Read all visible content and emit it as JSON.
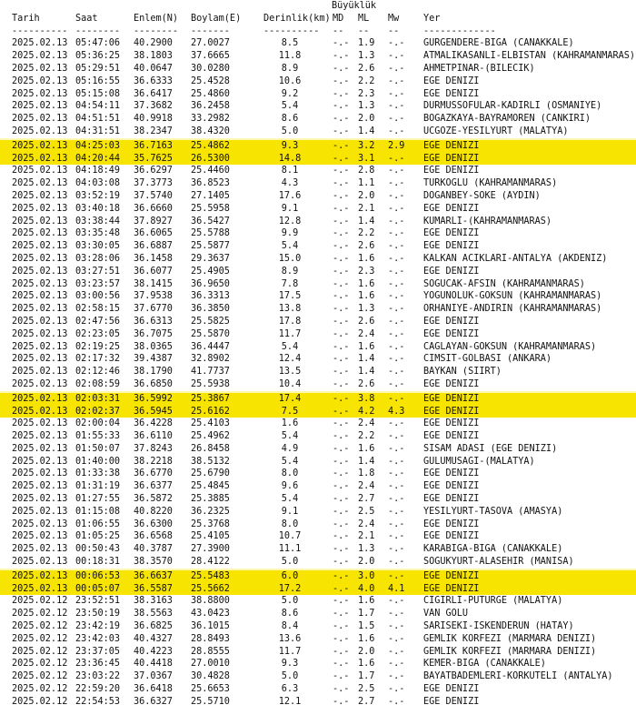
{
  "title_line": "Büyüklük",
  "headers": {
    "date": "Tarih",
    "time": "Saat",
    "lat": "Enlem(N)",
    "lon": "Boylam(E)",
    "depth": "Derinlik(km)",
    "md": "MD",
    "ml": "ML",
    "mw": "Mw",
    "loc": "Yer"
  },
  "dashes": {
    "date": "----------",
    "time": "--------",
    "lat": "--------",
    "lon": "-------",
    "depth": "----------",
    "md": "--",
    "ml": "--",
    "mw": "--",
    "loc": "-------------"
  },
  "rows": [
    {
      "date": "2025.02.13",
      "time": "05:47:06",
      "lat": "40.2900",
      "lon": "27.0027",
      "depth": "8.5",
      "md": "-.-",
      "ml": "1.9",
      "mw": "-.-",
      "loc": "GURGENDERE-BIGA (CANAKKALE)"
    },
    {
      "date": "2025.02.13",
      "time": "05:36:25",
      "lat": "38.1803",
      "lon": "37.6665",
      "depth": "11.8",
      "md": "-.-",
      "ml": "1.3",
      "mw": "-.-",
      "loc": "ATMALIKASANLI-ELBISTAN (KAHRAMANMARAS)"
    },
    {
      "date": "2025.02.13",
      "time": "05:29:51",
      "lat": "40.0647",
      "lon": "30.0280",
      "depth": "8.9",
      "md": "-.-",
      "ml": "2.6",
      "mw": "-.-",
      "loc": "AHMETPINAR-(BILECIK)"
    },
    {
      "date": "2025.02.13",
      "time": "05:16:55",
      "lat": "36.6333",
      "lon": "25.4528",
      "depth": "10.6",
      "md": "-.-",
      "ml": "2.2",
      "mw": "-.-",
      "loc": "EGE DENIZI"
    },
    {
      "date": "2025.02.13",
      "time": "05:15:08",
      "lat": "36.6417",
      "lon": "25.4860",
      "depth": "9.2",
      "md": "-.-",
      "ml": "2.3",
      "mw": "-.-",
      "loc": "EGE DENIZI"
    },
    {
      "date": "2025.02.13",
      "time": "04:54:11",
      "lat": "37.3682",
      "lon": "36.2458",
      "depth": "5.4",
      "md": "-.-",
      "ml": "1.3",
      "mw": "-.-",
      "loc": "DURMUSSOFULAR-KADIRLI (OSMANIYE)"
    },
    {
      "date": "2025.02.13",
      "time": "04:51:51",
      "lat": "40.9918",
      "lon": "33.2982",
      "depth": "8.6",
      "md": "-.-",
      "ml": "2.0",
      "mw": "-.-",
      "loc": "BOGAZKAYA-BAYRAMOREN (CANKIRI)"
    },
    {
      "date": "2025.02.13",
      "time": "04:31:51",
      "lat": "38.2347",
      "lon": "38.4320",
      "depth": "5.0",
      "md": "-.-",
      "ml": "1.4",
      "mw": "-.-",
      "loc": "UCGOZE-YESILYURT (MALATYA)"
    },
    {
      "date": "2025.02.13",
      "time": "04:25:03",
      "lat": "36.7163",
      "lon": "25.4862",
      "depth": "9.3",
      "md": "-.-",
      "ml": "3.2",
      "mw": "2.9",
      "loc": "EGE DENIZI",
      "hl": true
    },
    {
      "date": "2025.02.13",
      "time": "04:20:44",
      "lat": "35.7625",
      "lon": "26.5300",
      "depth": "14.8",
      "md": "-.-",
      "ml": "3.1",
      "mw": "-.-",
      "loc": "EGE DENIZI",
      "hl": true
    },
    {
      "date": "2025.02.13",
      "time": "04:18:49",
      "lat": "36.6297",
      "lon": "25.4460",
      "depth": "8.1",
      "md": "-.-",
      "ml": "2.8",
      "mw": "-.-",
      "loc": "EGE DENIZI"
    },
    {
      "date": "2025.02.13",
      "time": "04:03:08",
      "lat": "37.3773",
      "lon": "36.8523",
      "depth": "4.3",
      "md": "-.-",
      "ml": "1.1",
      "mw": "-.-",
      "loc": "TURKOGLU (KAHRAMANMARAS)"
    },
    {
      "date": "2025.02.13",
      "time": "03:52:19",
      "lat": "37.5740",
      "lon": "27.1405",
      "depth": "17.6",
      "md": "-.-",
      "ml": "2.0",
      "mw": "-.-",
      "loc": "DOGANBEY-SOKE (AYDIN)"
    },
    {
      "date": "2025.02.13",
      "time": "03:40:18",
      "lat": "36.6660",
      "lon": "25.5958",
      "depth": "9.1",
      "md": "-.-",
      "ml": "2.1",
      "mw": "-.-",
      "loc": "EGE DENIZI"
    },
    {
      "date": "2025.02.13",
      "time": "03:38:44",
      "lat": "37.8927",
      "lon": "36.5427",
      "depth": "12.8",
      "md": "-.-",
      "ml": "1.4",
      "mw": "-.-",
      "loc": "KUMARLI-(KAHRAMANMARAS)"
    },
    {
      "date": "2025.02.13",
      "time": "03:35:48",
      "lat": "36.6065",
      "lon": "25.5788",
      "depth": "9.9",
      "md": "-.-",
      "ml": "2.2",
      "mw": "-.-",
      "loc": "EGE DENIZI"
    },
    {
      "date": "2025.02.13",
      "time": "03:30:05",
      "lat": "36.6887",
      "lon": "25.5877",
      "depth": "5.4",
      "md": "-.-",
      "ml": "2.6",
      "mw": "-.-",
      "loc": "EGE DENIZI"
    },
    {
      "date": "2025.02.13",
      "time": "03:28:06",
      "lat": "36.1458",
      "lon": "29.3637",
      "depth": "15.0",
      "md": "-.-",
      "ml": "1.6",
      "mw": "-.-",
      "loc": "KALKAN ACIKLARI-ANTALYA (AKDENIZ)"
    },
    {
      "date": "2025.02.13",
      "time": "03:27:51",
      "lat": "36.6077",
      "lon": "25.4905",
      "depth": "8.9",
      "md": "-.-",
      "ml": "2.3",
      "mw": "-.-",
      "loc": "EGE DENIZI"
    },
    {
      "date": "2025.02.13",
      "time": "03:23:57",
      "lat": "38.1415",
      "lon": "36.9650",
      "depth": "7.8",
      "md": "-.-",
      "ml": "1.6",
      "mw": "-.-",
      "loc": "SOGUCAK-AFSIN (KAHRAMANMARAS)"
    },
    {
      "date": "2025.02.13",
      "time": "03:00:56",
      "lat": "37.9538",
      "lon": "36.3313",
      "depth": "17.5",
      "md": "-.-",
      "ml": "1.6",
      "mw": "-.-",
      "loc": "YOGUNOLUK-GOKSUN (KAHRAMANMARAS)"
    },
    {
      "date": "2025.02.13",
      "time": "02:58:15",
      "lat": "37.6770",
      "lon": "36.3850",
      "depth": "13.8",
      "md": "-.-",
      "ml": "1.3",
      "mw": "-.-",
      "loc": "ORHANIYE-ANDIRIN (KAHRAMANMARAS)"
    },
    {
      "date": "2025.02.13",
      "time": "02:47:56",
      "lat": "36.6313",
      "lon": "25.5825",
      "depth": "17.8",
      "md": "-.-",
      "ml": "2.6",
      "mw": "-.-",
      "loc": "EGE DENIZI"
    },
    {
      "date": "2025.02.13",
      "time": "02:23:05",
      "lat": "36.7075",
      "lon": "25.5870",
      "depth": "11.7",
      "md": "-.-",
      "ml": "2.4",
      "mw": "-.-",
      "loc": "EGE DENIZI"
    },
    {
      "date": "2025.02.13",
      "time": "02:19:25",
      "lat": "38.0365",
      "lon": "36.4447",
      "depth": "5.4",
      "md": "-.-",
      "ml": "1.6",
      "mw": "-.-",
      "loc": "CAGLAYAN-GOKSUN (KAHRAMANMARAS)"
    },
    {
      "date": "2025.02.13",
      "time": "02:17:32",
      "lat": "39.4387",
      "lon": "32.8902",
      "depth": "12.4",
      "md": "-.-",
      "ml": "1.4",
      "mw": "-.-",
      "loc": "CIMSIT-GOLBASI (ANKARA)"
    },
    {
      "date": "2025.02.13",
      "time": "02:12:46",
      "lat": "38.1790",
      "lon": "41.7737",
      "depth": "13.5",
      "md": "-.-",
      "ml": "1.4",
      "mw": "-.-",
      "loc": "BAYKAN (SIIRT)"
    },
    {
      "date": "2025.02.13",
      "time": "02:08:59",
      "lat": "36.6850",
      "lon": "25.5938",
      "depth": "10.4",
      "md": "-.-",
      "ml": "2.6",
      "mw": "-.-",
      "loc": "EGE DENIZI"
    },
    {
      "date": "2025.02.13",
      "time": "02:03:31",
      "lat": "36.5992",
      "lon": "25.3867",
      "depth": "17.4",
      "md": "-.-",
      "ml": "3.8",
      "mw": "-.-",
      "loc": "EGE DENIZI",
      "hl": true
    },
    {
      "date": "2025.02.13",
      "time": "02:02:37",
      "lat": "36.5945",
      "lon": "25.6162",
      "depth": "7.5",
      "md": "-.-",
      "ml": "4.2",
      "mw": "4.3",
      "loc": "EGE DENIZI",
      "hl": true
    },
    {
      "date": "2025.02.13",
      "time": "02:00:04",
      "lat": "36.4228",
      "lon": "25.4103",
      "depth": "1.6",
      "md": "-.-",
      "ml": "2.4",
      "mw": "-.-",
      "loc": "EGE DENIZI"
    },
    {
      "date": "2025.02.13",
      "time": "01:55:33",
      "lat": "36.6110",
      "lon": "25.4962",
      "depth": "5.4",
      "md": "-.-",
      "ml": "2.2",
      "mw": "-.-",
      "loc": "EGE DENIZI"
    },
    {
      "date": "2025.02.13",
      "time": "01:50:07",
      "lat": "37.8243",
      "lon": "26.8458",
      "depth": "4.9",
      "md": "-.-",
      "ml": "1.6",
      "mw": "-.-",
      "loc": "SISAM ADASI (EGE DENIZI)"
    },
    {
      "date": "2025.02.13",
      "time": "01:40:00",
      "lat": "38.2218",
      "lon": "38.5132",
      "depth": "5.4",
      "md": "-.-",
      "ml": "1.4",
      "mw": "-.-",
      "loc": "GULUMUSAGI-(MALATYA)"
    },
    {
      "date": "2025.02.13",
      "time": "01:33:38",
      "lat": "36.6770",
      "lon": "25.6790",
      "depth": "8.0",
      "md": "-.-",
      "ml": "1.8",
      "mw": "-.-",
      "loc": "EGE DENIZI"
    },
    {
      "date": "2025.02.13",
      "time": "01:31:19",
      "lat": "36.6377",
      "lon": "25.4845",
      "depth": "9.6",
      "md": "-.-",
      "ml": "2.4",
      "mw": "-.-",
      "loc": "EGE DENIZI"
    },
    {
      "date": "2025.02.13",
      "time": "01:27:55",
      "lat": "36.5872",
      "lon": "25.3885",
      "depth": "5.4",
      "md": "-.-",
      "ml": "2.7",
      "mw": "-.-",
      "loc": "EGE DENIZI"
    },
    {
      "date": "2025.02.13",
      "time": "01:15:08",
      "lat": "40.8220",
      "lon": "36.2325",
      "depth": "9.1",
      "md": "-.-",
      "ml": "2.5",
      "mw": "-.-",
      "loc": "YESILYURT-TASOVA (AMASYA)"
    },
    {
      "date": "2025.02.13",
      "time": "01:06:55",
      "lat": "36.6300",
      "lon": "25.3768",
      "depth": "8.0",
      "md": "-.-",
      "ml": "2.4",
      "mw": "-.-",
      "loc": "EGE DENIZI"
    },
    {
      "date": "2025.02.13",
      "time": "01:05:25",
      "lat": "36.6568",
      "lon": "25.4105",
      "depth": "10.7",
      "md": "-.-",
      "ml": "2.1",
      "mw": "-.-",
      "loc": "EGE DENIZI"
    },
    {
      "date": "2025.02.13",
      "time": "00:50:43",
      "lat": "40.3787",
      "lon": "27.3900",
      "depth": "11.1",
      "md": "-.-",
      "ml": "1.3",
      "mw": "-.-",
      "loc": "KARABIGA-BIGA (CANAKKALE)"
    },
    {
      "date": "2025.02.13",
      "time": "00:18:31",
      "lat": "38.3570",
      "lon": "28.4122",
      "depth": "5.0",
      "md": "-.-",
      "ml": "2.0",
      "mw": "-.-",
      "loc": "SOGUKYURT-ALASEHIR (MANISA)"
    },
    {
      "date": "2025.02.13",
      "time": "00:06:53",
      "lat": "36.6637",
      "lon": "25.5483",
      "depth": "6.0",
      "md": "-.-",
      "ml": "3.0",
      "mw": "-.-",
      "loc": "EGE DENIZI",
      "hl": true
    },
    {
      "date": "2025.02.13",
      "time": "00:05:07",
      "lat": "36.5587",
      "lon": "25.5662",
      "depth": "17.2",
      "md": "-.-",
      "ml": "4.0",
      "mw": "4.1",
      "loc": "EGE DENIZI",
      "hl": true
    },
    {
      "date": "2025.02.12",
      "time": "23:52:51",
      "lat": "38.3163",
      "lon": "38.8800",
      "depth": "5.0",
      "md": "-.-",
      "ml": "1.6",
      "mw": "-.-",
      "loc": "CIGIRLI-PUTURGE (MALATYA)"
    },
    {
      "date": "2025.02.12",
      "time": "23:50:19",
      "lat": "38.5563",
      "lon": "43.0423",
      "depth": "8.6",
      "md": "-.-",
      "ml": "1.7",
      "mw": "-.-",
      "loc": "VAN GOLU"
    },
    {
      "date": "2025.02.12",
      "time": "23:42:19",
      "lat": "36.6825",
      "lon": "36.1015",
      "depth": "8.4",
      "md": "-.-",
      "ml": "1.5",
      "mw": "-.-",
      "loc": "SARISEKI-ISKENDERUN (HATAY)"
    },
    {
      "date": "2025.02.12",
      "time": "23:42:03",
      "lat": "40.4327",
      "lon": "28.8493",
      "depth": "13.6",
      "md": "-.-",
      "ml": "1.6",
      "mw": "-.-",
      "loc": "GEMLIK KORFEZI (MARMARA DENIZI)"
    },
    {
      "date": "2025.02.12",
      "time": "23:37:05",
      "lat": "40.4223",
      "lon": "28.8555",
      "depth": "11.7",
      "md": "-.-",
      "ml": "2.0",
      "mw": "-.-",
      "loc": "GEMLIK KORFEZI (MARMARA DENIZI)"
    },
    {
      "date": "2025.02.12",
      "time": "23:36:45",
      "lat": "40.4418",
      "lon": "27.0010",
      "depth": "9.3",
      "md": "-.-",
      "ml": "1.6",
      "mw": "-.-",
      "loc": "KEMER-BIGA (CANAKKALE)"
    },
    {
      "date": "2025.02.12",
      "time": "23:03:22",
      "lat": "37.0367",
      "lon": "30.4828",
      "depth": "5.0",
      "md": "-.-",
      "ml": "1.7",
      "mw": "-.-",
      "loc": "BAYATBADEMLERI-KORKUTELI (ANTALYA)"
    },
    {
      "date": "2025.02.12",
      "time": "22:59:20",
      "lat": "36.6418",
      "lon": "25.6653",
      "depth": "6.3",
      "md": "-.-",
      "ml": "2.5",
      "mw": "-.-",
      "loc": "EGE DENIZI"
    },
    {
      "date": "2025.02.12",
      "time": "22:54:53",
      "lat": "36.6327",
      "lon": "25.5710",
      "depth": "12.1",
      "md": "-.-",
      "ml": "2.7",
      "mw": "-.-",
      "loc": "EGE DENIZI"
    }
  ]
}
